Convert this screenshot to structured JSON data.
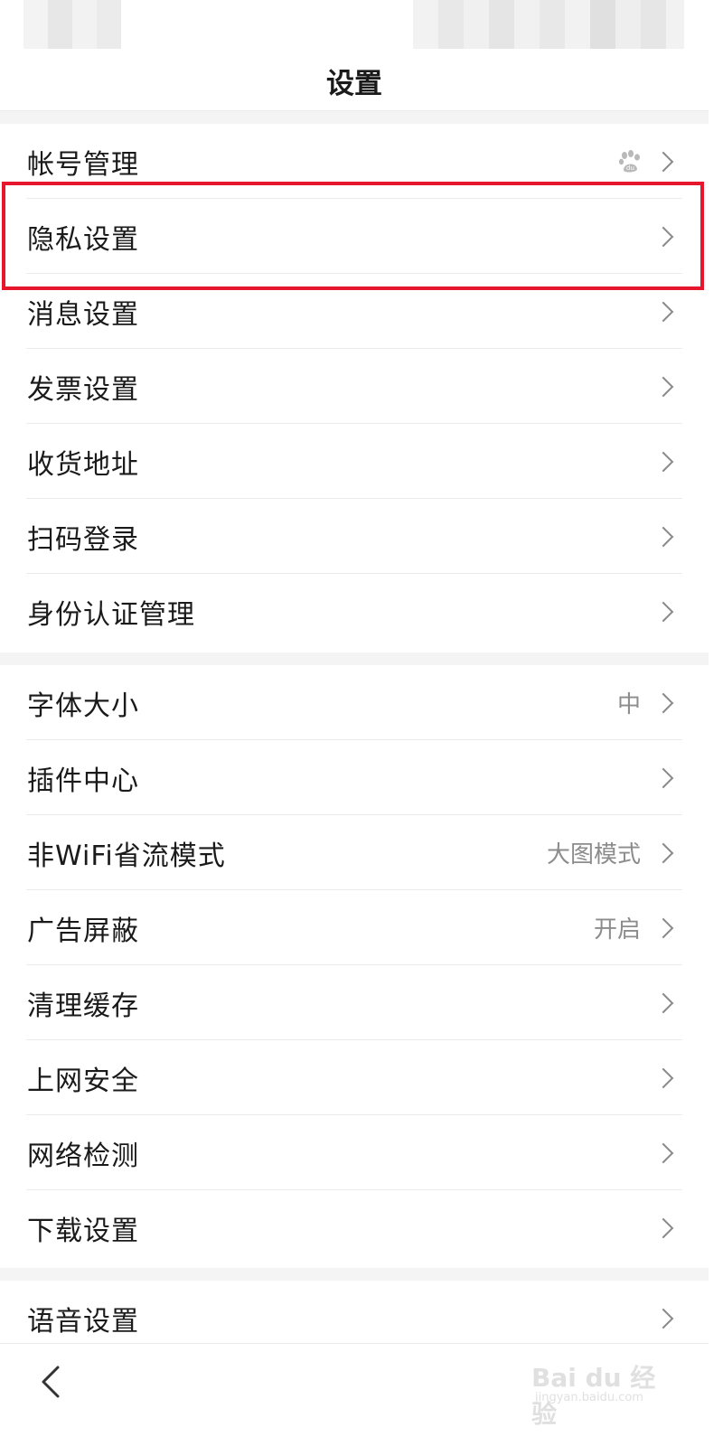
{
  "header": {
    "title": "设置"
  },
  "groups": [
    {
      "items": [
        {
          "label": "帐号管理",
          "value": "",
          "icon": "baidu-paw-icon"
        },
        {
          "label": "隐私设置",
          "value": ""
        },
        {
          "label": "消息设置",
          "value": ""
        },
        {
          "label": "发票设置",
          "value": ""
        },
        {
          "label": "收货地址",
          "value": ""
        },
        {
          "label": "扫码登录",
          "value": ""
        },
        {
          "label": "身份认证管理",
          "value": ""
        }
      ]
    },
    {
      "items": [
        {
          "label": "字体大小",
          "value": "中"
        },
        {
          "label": "插件中心",
          "value": ""
        },
        {
          "label": "非WiFi省流模式",
          "value": "大图模式"
        },
        {
          "label": "广告屏蔽",
          "value": "开启"
        },
        {
          "label": "清理缓存",
          "value": ""
        },
        {
          "label": "上网安全",
          "value": ""
        },
        {
          "label": "网络检测",
          "value": ""
        },
        {
          "label": "下载设置",
          "value": ""
        }
      ]
    },
    {
      "items": [
        {
          "label": "语音设置",
          "value": ""
        }
      ]
    }
  ],
  "highlight": {
    "target": "隐私设置",
    "color": "#e6162d"
  },
  "bottom_bar": {
    "back_icon": "chevron-left-icon"
  },
  "watermark": {
    "text": "Bai du 经验",
    "sub": "jingyan.baidu.com"
  },
  "colors": {
    "accent": "#e6162d",
    "separator": "#f4f4f4",
    "secondary_text": "#8c8c8c"
  }
}
